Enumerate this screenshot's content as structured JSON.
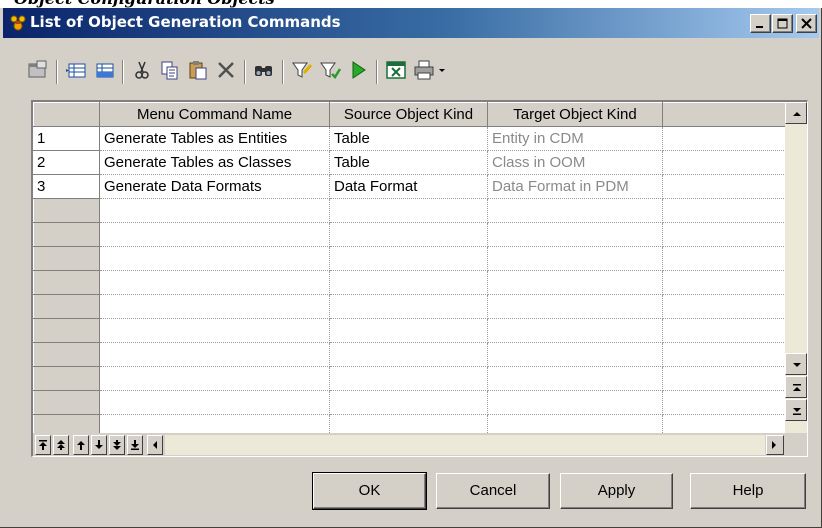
{
  "window": {
    "title": "List of Object Generation Commands",
    "top_fragment": "Object Configuration Objects",
    "title_gradient": [
      "#0a246a",
      "#3a6ea5",
      "#a6caf0"
    ]
  },
  "toolbar": {
    "icons": [
      "properties-icon",
      "insert-row-icon",
      "add-row-icon",
      "cut-icon",
      "copy-icon",
      "paste-icon",
      "delete-icon",
      "find-icon",
      "filter-icon",
      "clear-filter-icon",
      "apply-icon",
      "export-excel-icon",
      "print-icon",
      "dropdown-arrow-icon"
    ]
  },
  "grid": {
    "columns": [
      "Menu Command Name",
      "Source Object Kind",
      "Target Object Kind",
      ""
    ],
    "rows": [
      {
        "num": "1",
        "name": "Generate Tables as Entities",
        "source": "Table",
        "target": "Entity in CDM"
      },
      {
        "num": "2",
        "name": "Generate Tables as Classes",
        "source": "Table",
        "target": "Class in OOM"
      },
      {
        "num": "3",
        "name": "Generate Data Formats",
        "source": "Data Format",
        "target": "Data Format in PDM"
      }
    ],
    "empty_rows": 10
  },
  "buttons": {
    "ok": "OK",
    "cancel": "Cancel",
    "apply": "Apply",
    "help": "Help"
  }
}
